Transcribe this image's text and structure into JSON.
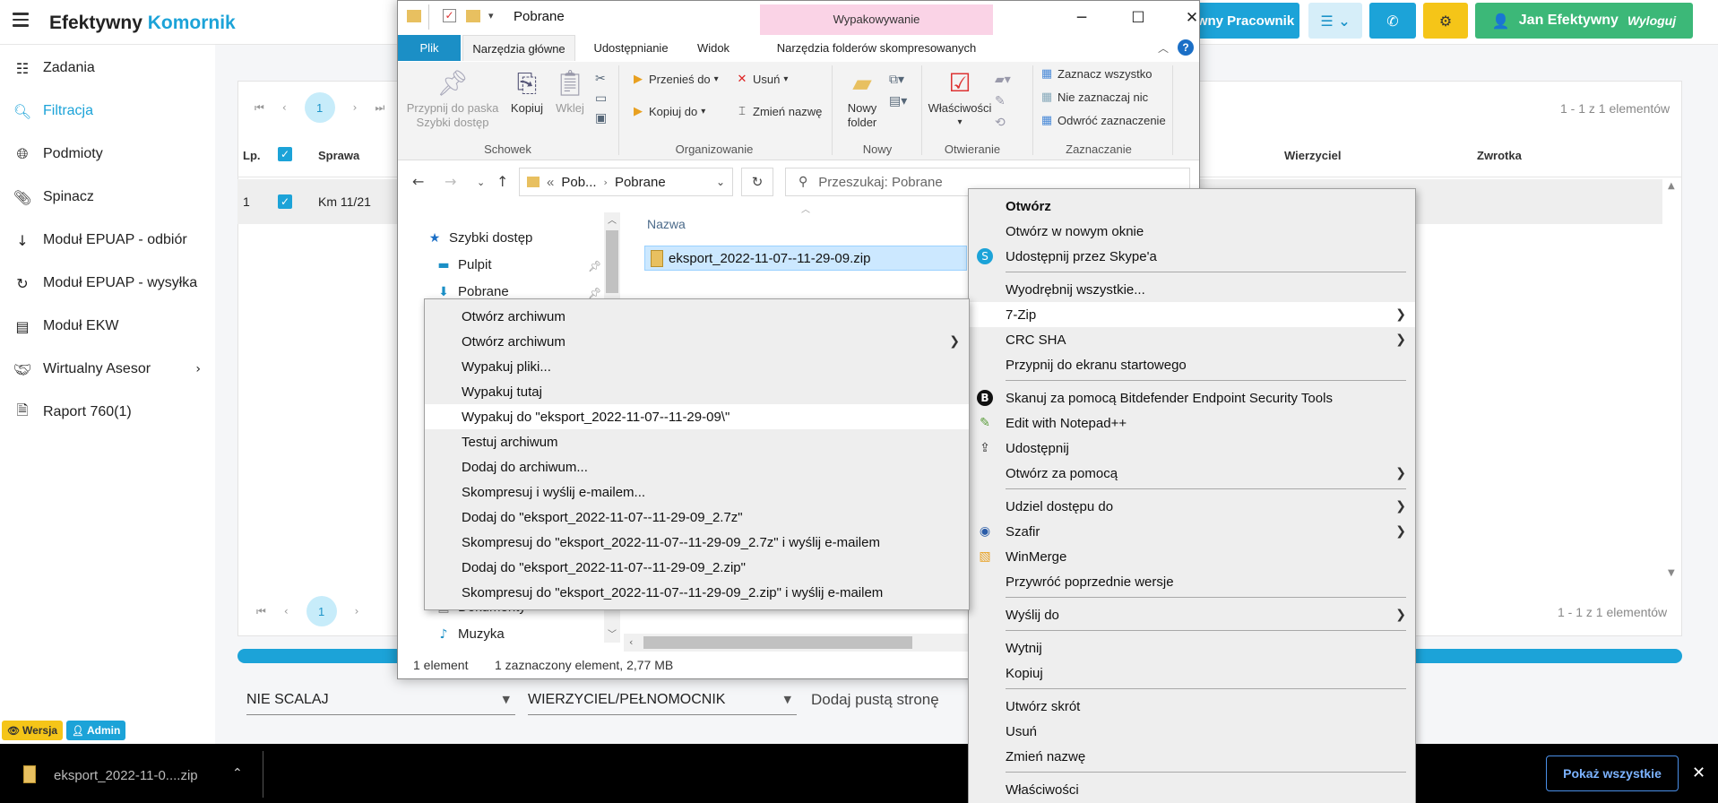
{
  "app": {
    "brand_main": "Efektywny",
    "brand_accent": "Komornik",
    "header_user_btn": "wny Pracownik",
    "user_name": "Jan Efektywny",
    "logout": "Wyloguj"
  },
  "sidebar": {
    "items": [
      {
        "label": "Zadania",
        "icon": "list-icon"
      },
      {
        "label": "Filtracja",
        "icon": "search-icon"
      },
      {
        "label": "Podmioty",
        "icon": "globe-icon"
      },
      {
        "label": "Spinacz",
        "icon": "paperclip-icon"
      },
      {
        "label": "Moduł EPUAP - odbiór",
        "icon": "arrow-down-icon"
      },
      {
        "label": "Moduł EPUAP - wysyłka",
        "icon": "refresh-icon"
      },
      {
        "label": "Moduł EKW",
        "icon": "book-icon"
      },
      {
        "label": "Wirtualny Asesor",
        "icon": "handshake-icon"
      },
      {
        "label": "Raport 760(1)",
        "icon": "report-icon"
      }
    ]
  },
  "table": {
    "page": "1",
    "range_top": "1 - 1 z 1 elementów",
    "range_bottom": "1 - 1 z 1 elementów",
    "col_lp": "Lp.",
    "col_sprawa": "Sprawa",
    "col_wierzyciel": "Wierzyciel",
    "col_zwrotka": "Zwrotka",
    "row_lp": "1",
    "row_sprawa": "Km 11/21"
  },
  "footer": {
    "select1": "NIE SCALAJ",
    "select2": "WIERZYCIEL/PEŁNOMOCNIK",
    "empty_page": "Dodaj pustą stronę",
    "badge_version": "Wersja",
    "badge_admin": "Admin"
  },
  "downloads": {
    "file": "eksport_2022-11-0....zip",
    "show_all": "Pokaż wszystkie"
  },
  "explorer": {
    "title": "Pobrane",
    "context_tab": "Wypakowywanie",
    "tabs": [
      "Plik",
      "Narzędzia główne",
      "Udostępnianie",
      "Widok",
      "Narzędzia folderów skompresowanych"
    ],
    "ribbon": {
      "pin": "Przypnij do paska Szybki dostęp",
      "copy": "Kopiuj",
      "paste": "Wklej",
      "move_to": "Przenieś do",
      "copy_to": "Kopiuj do",
      "delete": "Usuń",
      "rename": "Zmień nazwę",
      "new_folder": "Nowy folder",
      "properties": "Właściwości",
      "select_all": "Zaznacz wszystko",
      "select_none": "Nie zaznaczaj nic",
      "invert": "Odwróć zaznaczenie",
      "groups": [
        "Schowek",
        "Organizowanie",
        "Nowy",
        "Otwieranie",
        "Zaznaczanie"
      ]
    },
    "address_prefix": "Pob...",
    "address": "Pobrane",
    "search_placeholder": "Przeszukaj: Pobrane",
    "nav": {
      "quick": "Szybki dostęp",
      "desktop": "Pulpit",
      "downloads": "Pobrane",
      "documents": "Dokumenty",
      "music": "Muzyka"
    },
    "column_name": "Nazwa",
    "file": "eksport_2022-11-07--11-29-09.zip",
    "status_count": "1 element",
    "status_selected": "1 zaznaczony element, 2,77 MB"
  },
  "menu_main": {
    "items": [
      {
        "label": "Otwórz"
      },
      {
        "label": "Otwórz w nowym oknie"
      },
      {
        "label": "Udostępnij przez Skype'a"
      },
      {
        "label": "Wyodrębnij wszystkie..."
      },
      {
        "label": "7-Zip"
      },
      {
        "label": "CRC SHA"
      },
      {
        "label": "Przypnij do ekranu startowego"
      },
      {
        "label": "Skanuj za pomocą Bitdefender Endpoint Security Tools"
      },
      {
        "label": "Edit with Notepad++"
      },
      {
        "label": "Udostępnij"
      },
      {
        "label": "Otwórz za pomocą"
      },
      {
        "label": "Udziel dostępu do"
      },
      {
        "label": "Szafir"
      },
      {
        "label": "WinMerge"
      },
      {
        "label": "Przywróć poprzednie wersje"
      },
      {
        "label": "Wyślij do"
      },
      {
        "label": "Wytnij"
      },
      {
        "label": "Kopiuj"
      },
      {
        "label": "Utwórz skrót"
      },
      {
        "label": "Usuń"
      },
      {
        "label": "Zmień nazwę"
      },
      {
        "label": "Właściwości"
      }
    ]
  },
  "menu_7zip": {
    "items": [
      {
        "label": "Otwórz archiwum"
      },
      {
        "label": "Otwórz archiwum"
      },
      {
        "label": "Wypakuj pliki..."
      },
      {
        "label": "Wypakuj tutaj"
      },
      {
        "label": "Wypakuj do \"eksport_2022-11-07--11-29-09\\\""
      },
      {
        "label": "Testuj archiwum"
      },
      {
        "label": "Dodaj do archiwum..."
      },
      {
        "label": "Skompresuj i wyślij e-mailem..."
      },
      {
        "label": "Dodaj do \"eksport_2022-11-07--11-29-09_2.7z\""
      },
      {
        "label": "Skompresuj do \"eksport_2022-11-07--11-29-09_2.7z\" i wyślij e-mailem"
      },
      {
        "label": "Dodaj do \"eksport_2022-11-07--11-29-09_2.zip\""
      },
      {
        "label": "Skompresuj do \"eksport_2022-11-07--11-29-09_2.zip\" i wyślij e-mailem"
      }
    ]
  },
  "colors": {
    "accent": "#1ca3d8",
    "green": "#3cb878",
    "yellow": "#f5c518",
    "file_tab": "#1b8fc6"
  }
}
